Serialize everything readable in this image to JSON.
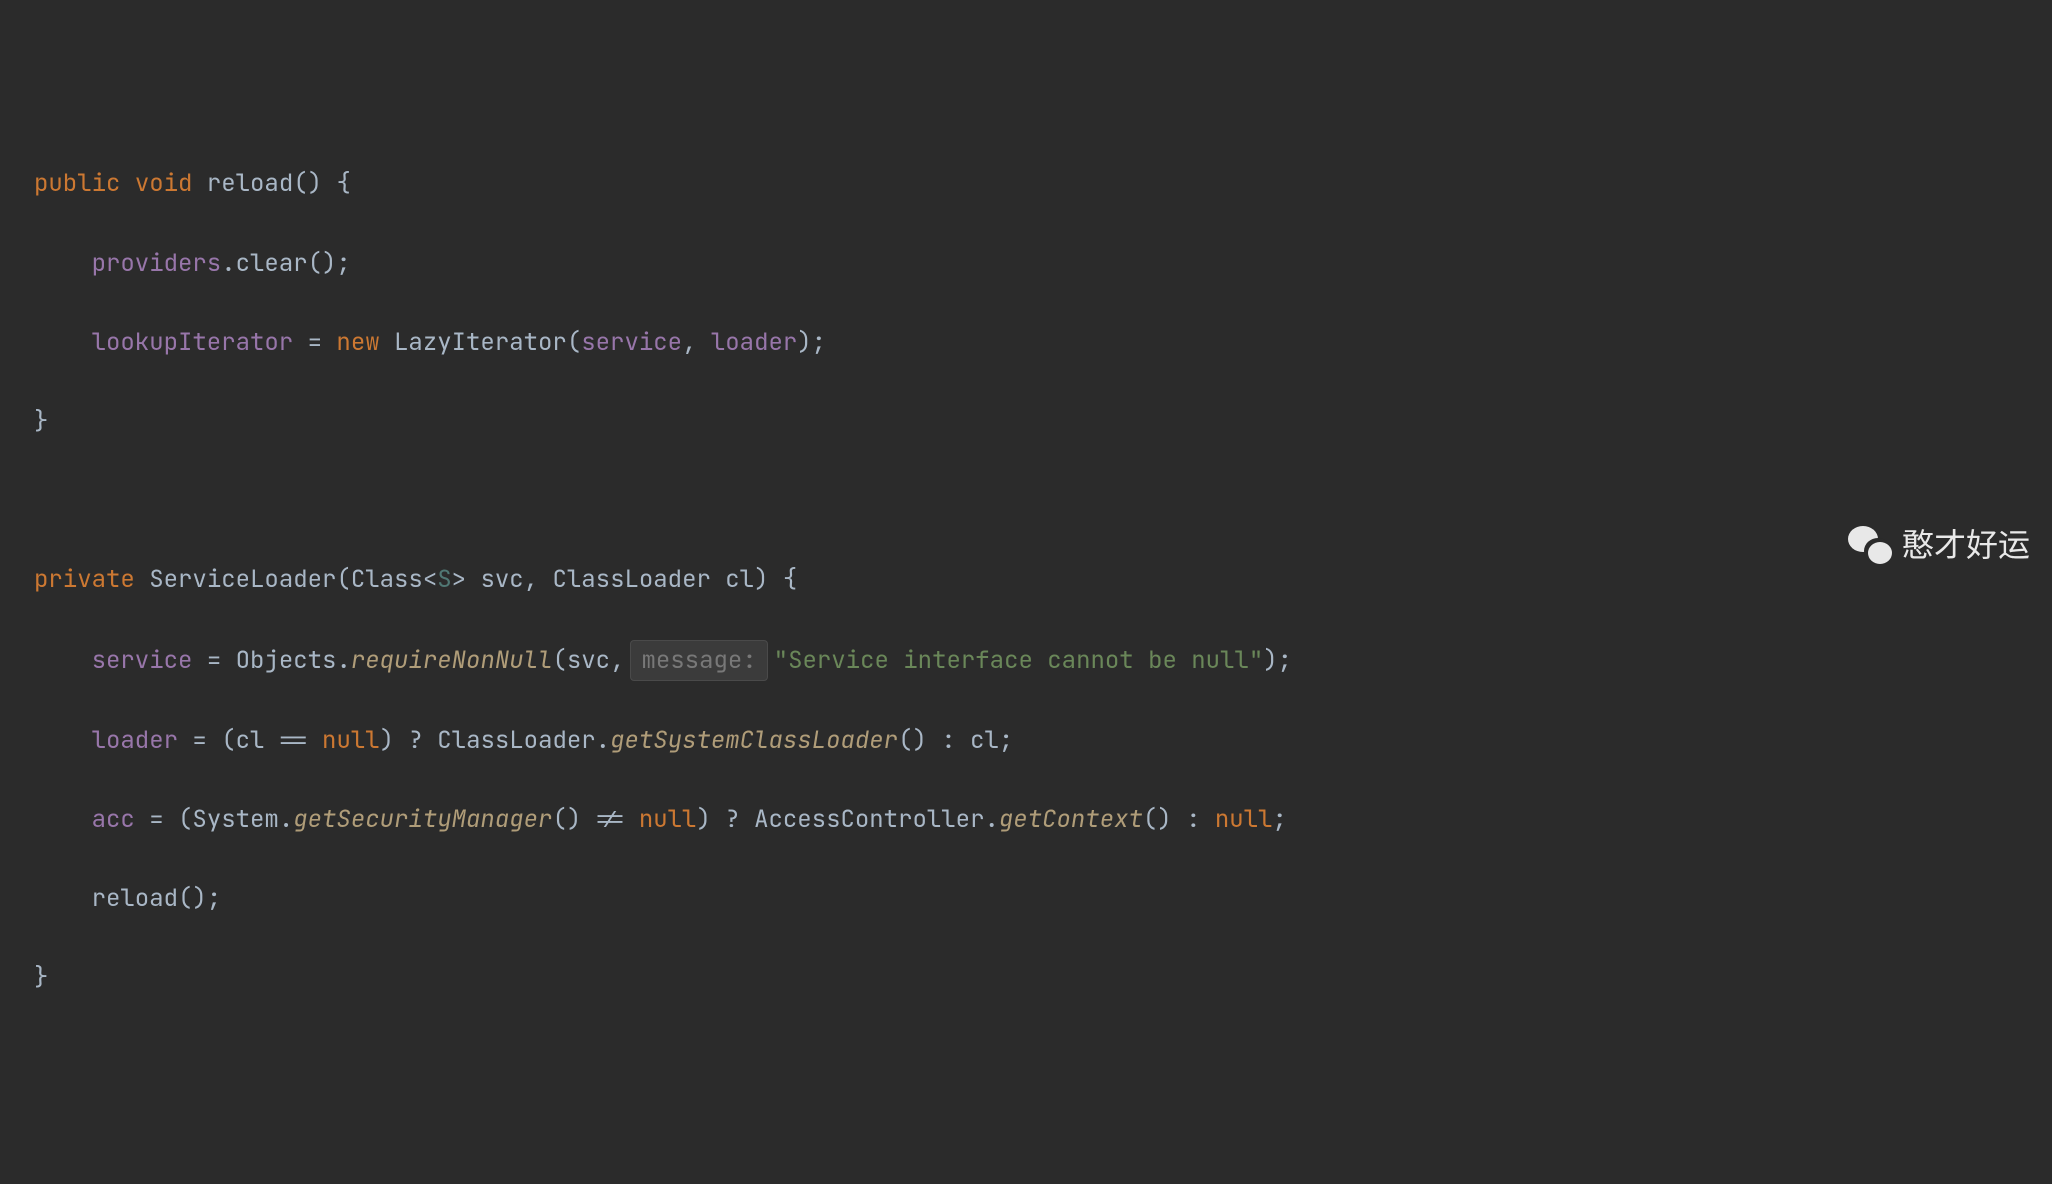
{
  "code": {
    "line1": {
      "kw_public": "public",
      "kw_void": "void",
      "method": "reload",
      "paren_open": "()",
      "brace_open": " {"
    },
    "line2": {
      "indent": "    ",
      "ident": "providers",
      "dot": ".",
      "call": "clear",
      "tail": "();"
    },
    "line3": {
      "indent": "    ",
      "ident": "lookupIterator",
      "eq": " = ",
      "kw_new": "new",
      "sp": " ",
      "ctor": "LazyIterator",
      "open": "(",
      "arg1": "service",
      "comma": ", ",
      "arg2": "loader",
      "close": ");"
    },
    "line4": {
      "brace_close": "}"
    },
    "line6": {
      "kw_private": "private",
      "sp": " ",
      "ctor": "ServiceLoader",
      "open": "(",
      "type1": "Class",
      "lt": "<",
      "generic": "S",
      "gt": ">",
      "sp2": " ",
      "p1": "svc",
      "comma": ", ",
      "type2": "ClassLoader",
      "sp3": " ",
      "p2": "cl",
      "close": ") {"
    },
    "line7": {
      "indent": "    ",
      "lhs": "service",
      "eq": " = ",
      "cls": "Objects",
      "dot": ".",
      "mtd": "requireNonNull",
      "open": "(",
      "arg1": "svc",
      "comma": ",",
      "hint": "message:",
      "str": "\"Service interface cannot be null\"",
      "close": ");"
    },
    "line8": {
      "indent": "    ",
      "lhs": "loader",
      "eq": " = (",
      "var": "cl",
      "eqeq": " == ",
      "null1": "null",
      "q": ") ? ",
      "cls": "ClassLoader",
      "dot": ".",
      "mtd": "getSystemClassLoader",
      "call": "()",
      "colon": " : ",
      "else": "cl",
      "semi": ";"
    },
    "line9": {
      "indent": "    ",
      "lhs": "acc",
      "eq": " = (",
      "cls1": "System",
      "dot1": ".",
      "mtd1": "getSecurityManager",
      "call1": "()",
      "neq": " != ",
      "null1": "null",
      "q": ") ? ",
      "cls2": "AccessController",
      "dot2": ".",
      "mtd2": "getContext",
      "call2": "()",
      "colon": " : ",
      "null2": "null",
      "semi": ";"
    },
    "line10": {
      "indent": "    ",
      "call": "reload",
      "tail": "();"
    },
    "line11": {
      "brace_close": "}"
    }
  },
  "watermark": {
    "text": "憨才好运"
  }
}
